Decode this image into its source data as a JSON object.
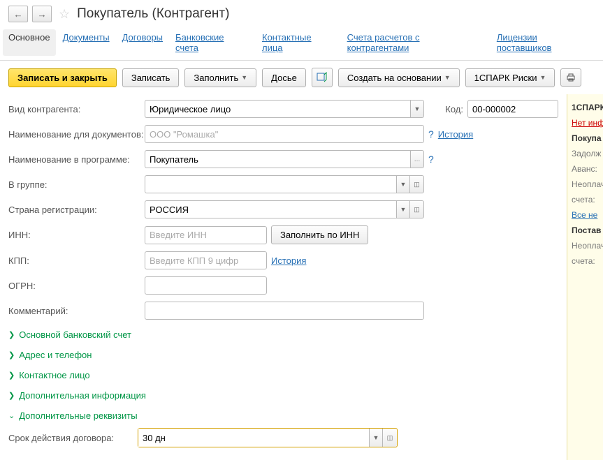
{
  "header": {
    "title": "Покупатель (Контрагент)"
  },
  "tabs": [
    "Основное",
    "Документы",
    "Договоры",
    "Банковские счета",
    "Контактные лица",
    "Счета расчетов с контрагентами",
    "Лицензии поставщиков"
  ],
  "toolbar": {
    "save_close": "Записать и закрыть",
    "save": "Записать",
    "fill": "Заполнить",
    "dossier": "Досье",
    "create_based": "Создать на основании",
    "spark": "1СПАРК Риски"
  },
  "form": {
    "type_label": "Вид контрагента:",
    "type_value": "Юридическое лицо",
    "code_label": "Код:",
    "code_value": "00-000002",
    "docname_label": "Наименование для документов:",
    "docname_placeholder": "ООО \"Ромашка\"",
    "history": "История",
    "progname_label": "Наименование в программе:",
    "progname_value": "Покупатель",
    "group_label": "В группе:",
    "country_label": "Страна регистрации:",
    "country_value": "РОССИЯ",
    "inn_label": "ИНН:",
    "inn_placeholder": "Введите ИНН",
    "inn_fill_btn": "Заполнить по ИНН",
    "kpp_label": "КПП:",
    "kpp_placeholder": "Введите КПП 9 цифр",
    "ogrn_label": "ОГРН:",
    "comment_label": "Комментарий:"
  },
  "expanders": {
    "bank": "Основной банковский счет",
    "address": "Адрес и телефон",
    "contact": "Контактное лицо",
    "extra_info": "Дополнительная информация",
    "extra_req": "Дополнительные реквизиты"
  },
  "contract": {
    "label": "Срок действия договора:",
    "value": "30 дн"
  },
  "sidebar": {
    "sec1_title": "1СПАРК",
    "sec1_err": "Нет инф",
    "sec2_title": "Покупа",
    "debt": "Задолж",
    "advance": "Аванс:",
    "unpaid1": "Неоплач",
    "account": "счета:",
    "all": "Все не",
    "sec3_title": "Постав",
    "unpaid2": "Неоплач",
    "account2": "счета:"
  }
}
